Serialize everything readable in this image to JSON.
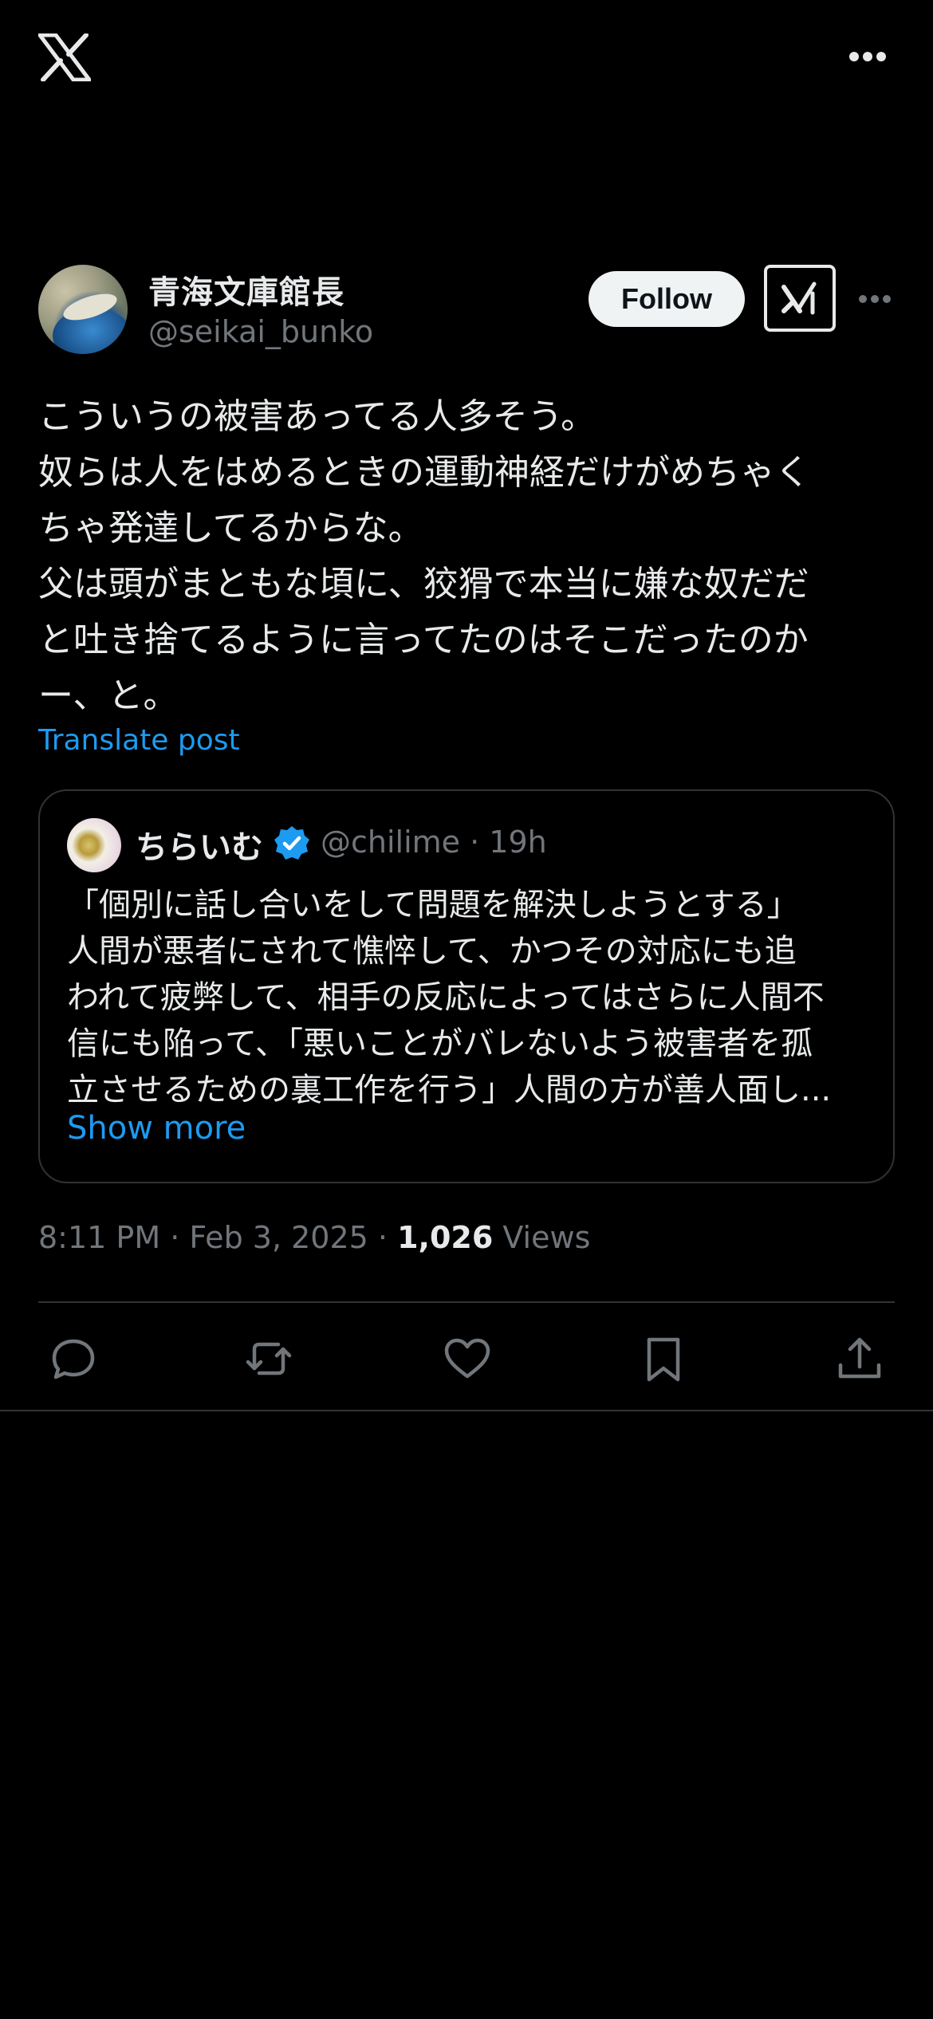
{
  "topbar": {
    "logo_icon": "x-logo-icon",
    "more_icon": "more-horizontal-icon"
  },
  "author": {
    "display_name": "青海文庫館長",
    "handle": "@seikai_bunko",
    "follow_label": "Follow",
    "grok_icon": "grok-icon",
    "more_icon": "more-horizontal-icon"
  },
  "tweet": {
    "text": "こういうの被害あってる人多そう。\n奴らは人をはめるときの運動神経だけがめちゃく\nちゃ発達してるからな。\n父は頭がまともな頃に、狡猾で本当に嫌な奴だだ\nと吐き捨てるように言ってたのはそこだったのか\nー、と。",
    "translate_label": "Translate post",
    "time": "8:11 PM",
    "separator": "·",
    "date": "Feb 3, 2025",
    "views_count": "1,026",
    "views_label": "Views"
  },
  "quote": {
    "display_name": "ちらいむ",
    "verified_icon": "verified-badge-icon",
    "handle_time": "@chilime · 19h",
    "text": "「個別に話し合いをして問題を解決しようとする」\n人間が悪者にされて憔悴して、かつその対応にも追\nわれて疲弊して、相手の反応によってはさらに人間不\n信にも陥って、「悪いことがバレないよう被害者を孤\n立させるための裏工作を行う」人間の方が善人面し...",
    "show_more_label": "Show more"
  },
  "actions": [
    {
      "name": "reply",
      "icon": "reply-icon"
    },
    {
      "name": "repost",
      "icon": "repost-icon"
    },
    {
      "name": "like",
      "icon": "heart-icon"
    },
    {
      "name": "bookmark",
      "icon": "bookmark-icon"
    },
    {
      "name": "share",
      "icon": "share-icon"
    }
  ],
  "colors": {
    "background": "#000000",
    "text": "#e7e9ea",
    "secondary": "#71767b",
    "accent": "#1d9bf0",
    "border": "#2f3336"
  }
}
